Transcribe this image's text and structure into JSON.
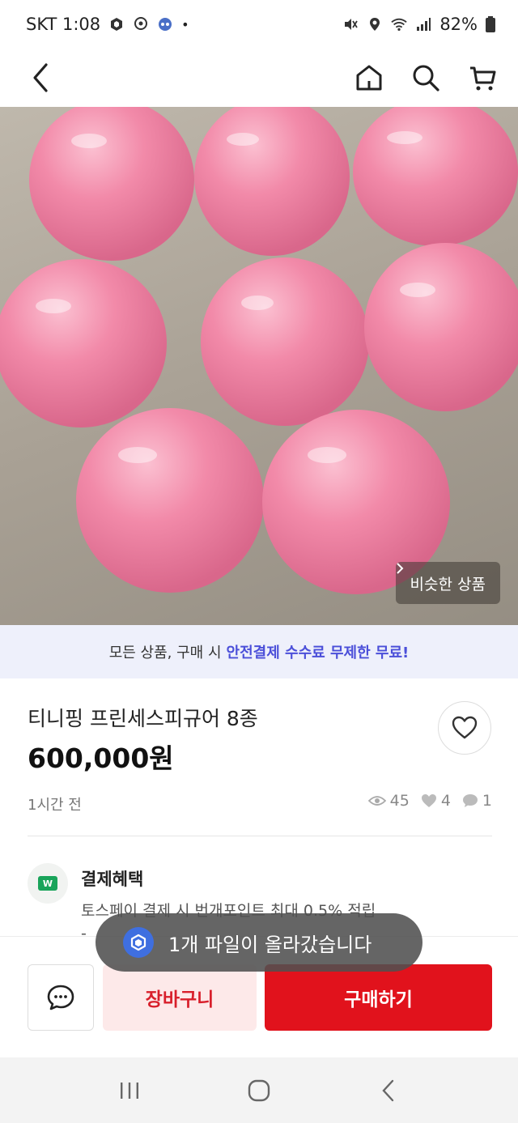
{
  "status_bar": {
    "carrier_time": "SKT 1:08",
    "dot": "•",
    "battery": "82%"
  },
  "nav": {
    "back_icon": "chevron-left-icon",
    "home_icon": "home-icon",
    "search_icon": "search-icon",
    "cart_icon": "cart-icon"
  },
  "hero": {
    "similar_label": "비슷한 상품"
  },
  "promo": {
    "prefix": "모든 상품, 구매 시",
    "highlight": "안전결제 수수료 무제한 무료!"
  },
  "product": {
    "title": "티니핑 프린세스피규어 8종",
    "price": "600,000원",
    "posted": "1시간 전",
    "views": "45",
    "likes": "4",
    "chats": "1"
  },
  "benefit": {
    "logo_text": "W",
    "title": "결제혜택",
    "desc": "토스페이 결제 시 번개포인트 최대 0.5% 적립",
    "desc2": "-"
  },
  "toast": {
    "message": "1개 파일이 올라갔습니다"
  },
  "bottom": {
    "cart_label": "장바구니",
    "buy_label": "구매하기"
  },
  "colors": {
    "accent_red": "#e1121c",
    "promo_blue": "#4b4fd9",
    "ball_pink": "#f08aa8"
  }
}
